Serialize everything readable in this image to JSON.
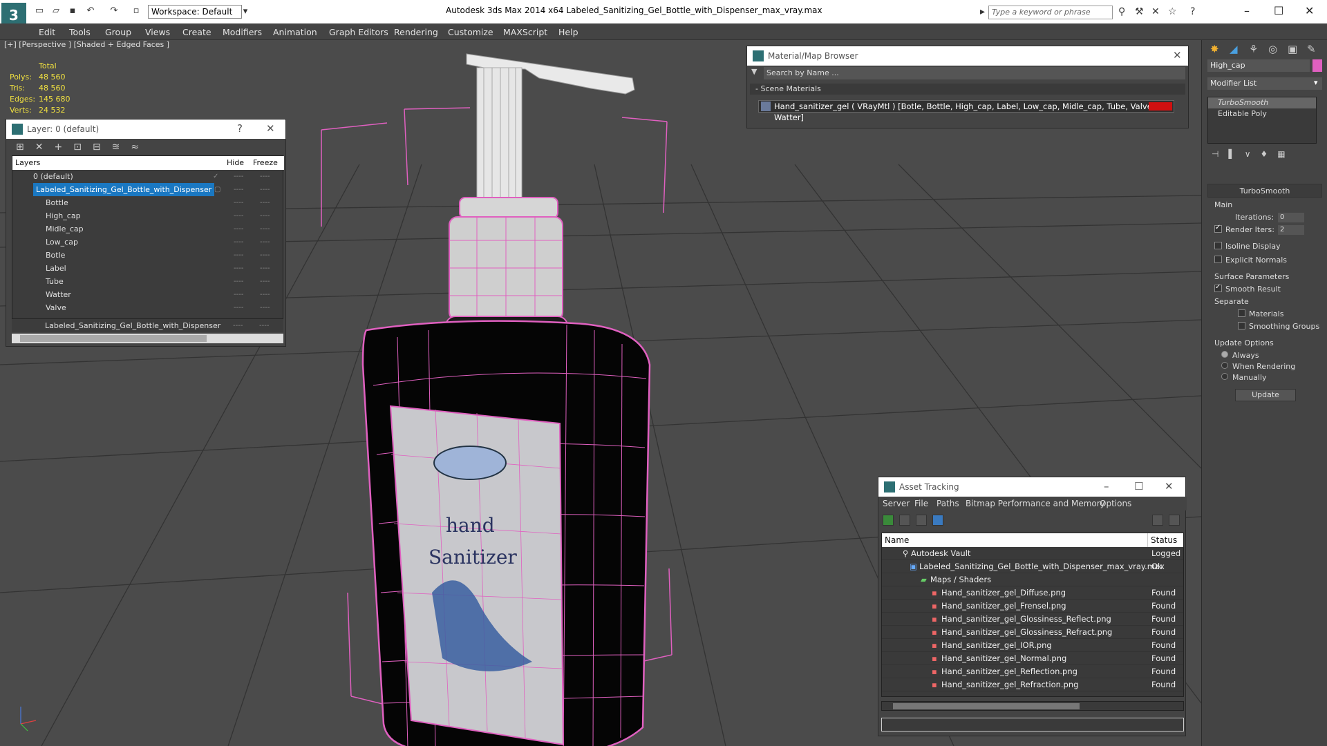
{
  "titlebar": {
    "workspace": "Workspace: Default",
    "app_title": "Autodesk 3ds Max  2014 x64      Labeled_Sanitizing_Gel_Bottle_with_Dispenser_max_vray.max",
    "search_placeholder": "Type a keyword or phrase"
  },
  "menu": [
    "Edit",
    "Tools",
    "Group",
    "Views",
    "Create",
    "Modifiers",
    "Animation",
    "Graph Editors",
    "Rendering",
    "Customize",
    "MAXScript",
    "Help"
  ],
  "viewport": {
    "label": "[+] [Perspective ] [Shaded + Edged Faces ]",
    "stats_header": "Total",
    "stats": [
      {
        "k": "Polys:",
        "v": "48 560"
      },
      {
        "k": "Tris:",
        "v": "48 560"
      },
      {
        "k": "Edges:",
        "v": "145 680"
      },
      {
        "k": "Verts:",
        "v": "24 532"
      }
    ]
  },
  "layer_panel": {
    "title": "Layer: 0 (default)",
    "col_layers": "Layers",
    "col_hide": "Hide",
    "col_freeze": "Freeze",
    "rows": [
      "0 (default)",
      "Labeled_Sanitizing_Gel_Bottle_with_Dispenser",
      "Bottle",
      "High_cap",
      "Midle_cap",
      "Low_cap",
      "Botle",
      "Label",
      "Tube",
      "Watter",
      "Valve",
      "Labeled_Sanitizing_Gel_Bottle_with_Dispenser"
    ]
  },
  "material_browser": {
    "title": "Material/Map Browser",
    "search": "Search by Name ...",
    "section": "- Scene Materials",
    "material": "Hand_sanitizer_gel  ( VRayMtl )  [Botle, Bottle, High_cap, Label, Low_cap, Midle_cap, Tube, Valve, Watter]"
  },
  "command_panel": {
    "object_name": "High_cap",
    "modifier_list": "Modifier List",
    "stack": [
      "TurboSmooth",
      "Editable Poly"
    ],
    "rollout": "TurboSmooth",
    "main": "Main",
    "iterations_label": "Iterations:",
    "iterations": "0",
    "render_iters_label": "Render Iters:",
    "render_iters": "2",
    "isoline": "Isoline Display",
    "explicit": "Explicit Normals",
    "surface": "Surface Parameters",
    "smooth": "Smooth Result",
    "separate": "Separate",
    "materials": "Materials",
    "smoothing_groups": "Smoothing Groups",
    "update_options": "Update Options",
    "always": "Always",
    "when_rendering": "When Rendering",
    "manually": "Manually",
    "update": "Update"
  },
  "asset_tracking": {
    "title": "Asset Tracking",
    "menu": [
      "Server",
      "File",
      "Paths",
      "Bitmap Performance and Memory",
      "Options"
    ],
    "col_name": "Name",
    "col_status": "Status",
    "rows": [
      {
        "name": "Autodesk Vault",
        "status": "Logged O"
      },
      {
        "name": "Labeled_Sanitizing_Gel_Bottle_with_Dispenser_max_vray.max",
        "status": "Ok"
      },
      {
        "name": "Maps / Shaders",
        "status": ""
      },
      {
        "name": "Hand_sanitizer_gel_Diffuse.png",
        "status": "Found"
      },
      {
        "name": "Hand_sanitizer_gel_Frensel.png",
        "status": "Found"
      },
      {
        "name": "Hand_sanitizer_gel_Glossiness_Reflect.png",
        "status": "Found"
      },
      {
        "name": "Hand_sanitizer_gel_Glossiness_Refract.png",
        "status": "Found"
      },
      {
        "name": "Hand_sanitizer_gel_IOR.png",
        "status": "Found"
      },
      {
        "name": "Hand_sanitizer_gel_Normal.png",
        "status": "Found"
      },
      {
        "name": "Hand_sanitizer_gel_Reflection.png",
        "status": "Found"
      },
      {
        "name": "Hand_sanitizer_gel_Refraction.png",
        "status": "Found"
      }
    ]
  },
  "scene": {
    "label_line1": "hand",
    "label_line2": "Sanitizer"
  }
}
